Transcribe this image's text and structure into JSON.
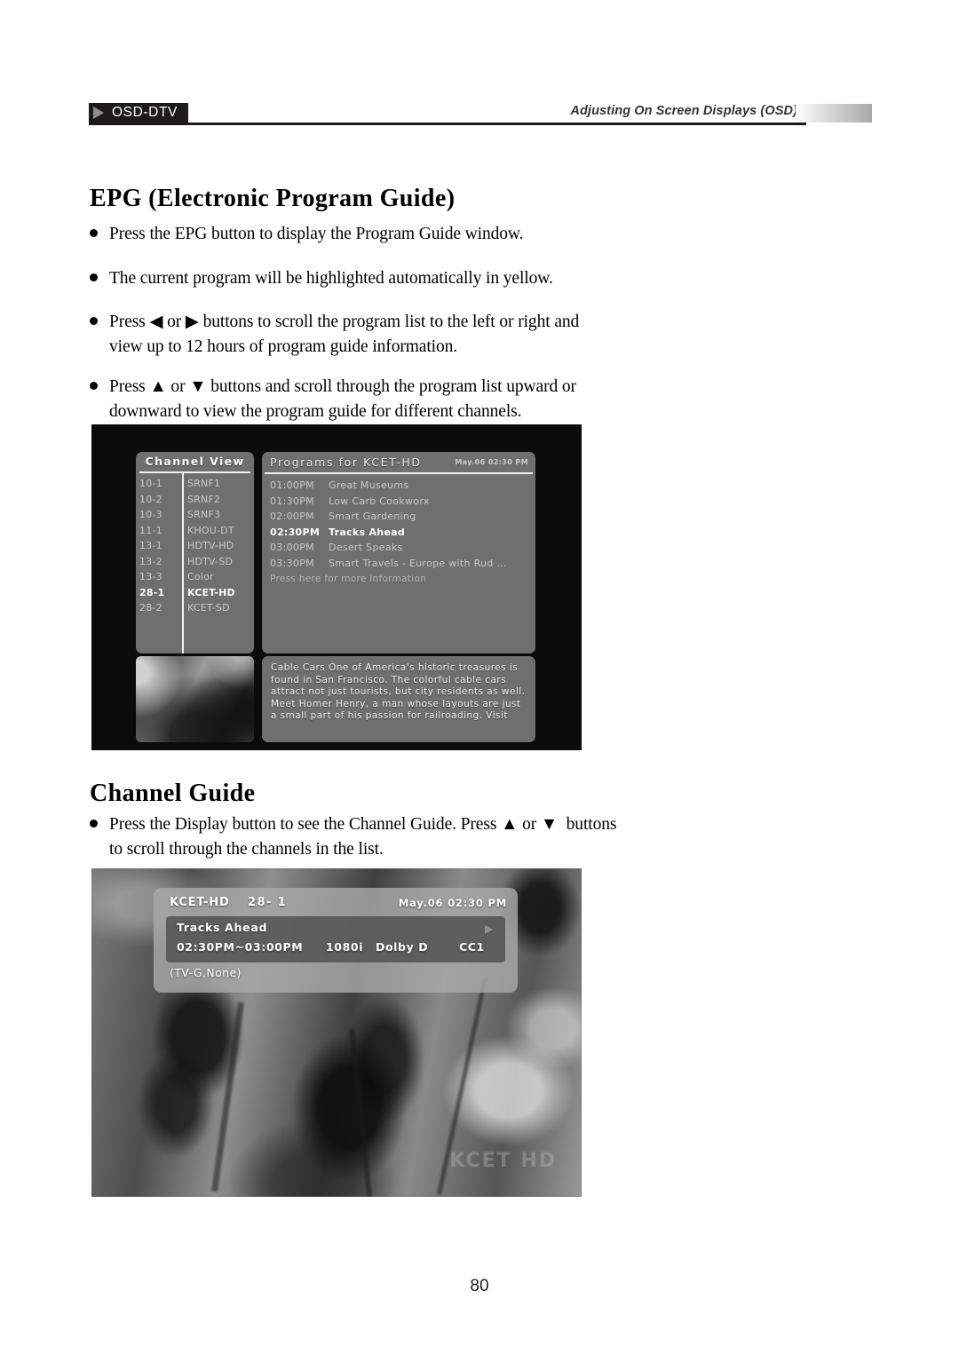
{
  "header": {
    "tab_label": "OSD-DTV",
    "section_title": "Adjusting On Screen Displays (OSD)"
  },
  "sections": {
    "epg": {
      "heading": "EPG (Electronic Program Guide)",
      "bullets": [
        "Press the EPG button to display the Program Guide window.",
        "The current program will be highlighted automatically in yellow.",
        "Press ◀ or ▶ buttons to scroll the program list to the left or right and\nview up to 12 hours of program guide information.",
        "Press ▲ or ▼ buttons and scroll through the program list upward or\ndownward to view the program guide for different channels."
      ]
    },
    "channel_guide": {
      "heading": "Channel Guide",
      "bullets": [
        "Press the Display button to see the Channel Guide. Press ▲ or ▼  buttons\nto scroll through the channels in the list."
      ]
    }
  },
  "epg_screen": {
    "channel_view": {
      "title": "Channel View",
      "rows": [
        {
          "number": "10-1",
          "name": "SRNF1",
          "active": false
        },
        {
          "number": "10-2",
          "name": "SRNF2",
          "active": false
        },
        {
          "number": "10-3",
          "name": "SRNF3",
          "active": false
        },
        {
          "number": "11-1",
          "name": "KHOU-DT",
          "active": false
        },
        {
          "number": "13-1",
          "name": "HDTV-HD",
          "active": false
        },
        {
          "number": "13-2",
          "name": "HDTV-SD",
          "active": false
        },
        {
          "number": "13-3",
          "name": "Color",
          "active": false
        },
        {
          "number": "28-1",
          "name": "KCET-HD",
          "active": true
        },
        {
          "number": "28-2",
          "name": "KCET-SD",
          "active": false
        }
      ]
    },
    "programs": {
      "title": "Programs for  KCET-HD",
      "clock": "May.06 02:30 PM",
      "rows": [
        {
          "time": "01:00PM",
          "name": "Great Museums",
          "active": false
        },
        {
          "time": "01:30PM",
          "name": "Low Carb Cookworx",
          "active": false
        },
        {
          "time": "02:00PM",
          "name": "Smart Gardening",
          "active": false
        },
        {
          "time": "02:30PM",
          "name": "Tracks Ahead",
          "active": true
        },
        {
          "time": "03:00PM",
          "name": "Desert Speaks",
          "active": false
        },
        {
          "time": "03:30PM",
          "name": "Smart Travels - Europe with Rud  ...",
          "active": false
        }
      ],
      "more_hint": "Press here for more information"
    },
    "description": "Cable Cars One of America's historic treasures is found in San Francisco.   The colorful cable cars attract not just tourists, but city residents as well.   Meet Homer Henry, a man whose layouts are just a small part of his passion for railroading.   Visit"
  },
  "guide_screen": {
    "channel_name": "KCET-HD",
    "channel_number": "28- 1",
    "datetime": "May.06 02:30  PM",
    "program_title": "Tracks Ahead",
    "time_range": "02:30PM~03:00PM",
    "resolution": "1080i",
    "audio": "Dolby  D",
    "caption": "CC1",
    "rating": "(TV-G,None)",
    "watermark": "KCET HD"
  },
  "footer": {
    "page_number": "80"
  }
}
